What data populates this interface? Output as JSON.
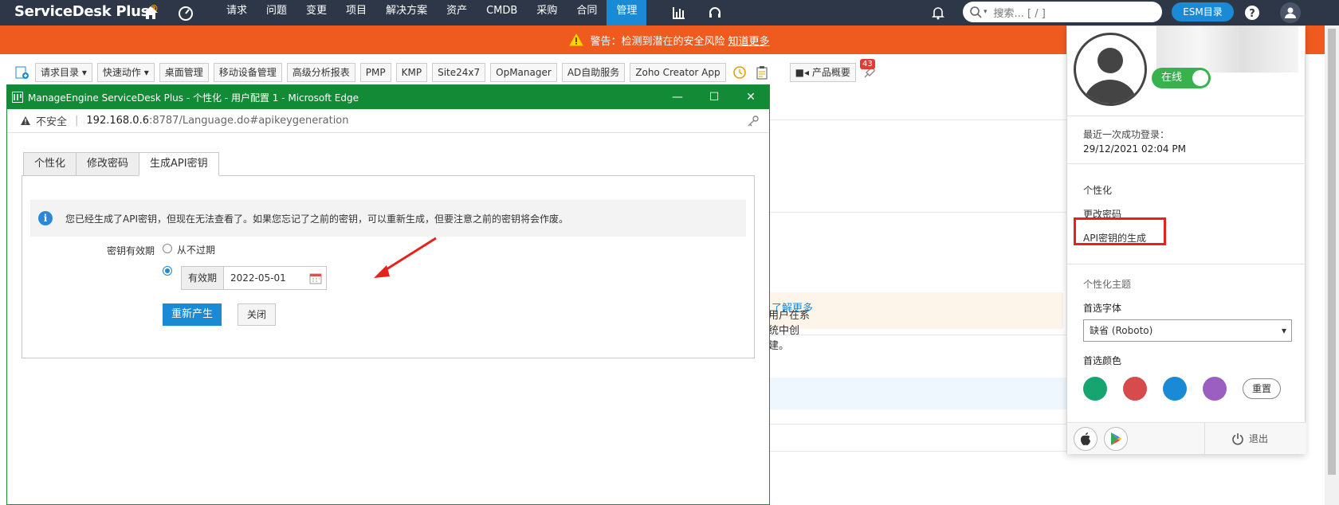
{
  "app": {
    "logo_main": "ServiceDesk Plus",
    "logo_mark": "®"
  },
  "nav": {
    "items": [
      "请求",
      "问题",
      "变更",
      "项目",
      "解决方案",
      "资产",
      "CMDB",
      "采购",
      "合同",
      "管理"
    ],
    "active": "管理",
    "search_placeholder": "搜索... [ / ]",
    "esm_label": "ESM目录"
  },
  "warning": {
    "text": "警告：检测到潜在的安全风险",
    "link": "知道更多"
  },
  "toolbar": {
    "items": [
      "请求目录",
      "快速动作",
      "桌面管理",
      "移动设备管理",
      "高级分析报表",
      "PMP",
      "KMP",
      "Site24x7",
      "OpManager",
      "AD自助服务",
      "Zoho Creator App",
      "产品概要"
    ],
    "badge": "43"
  },
  "bg": {
    "note_text": "用户在系统中创建。",
    "note_link": "了解更多"
  },
  "edge": {
    "title": "ManageEngine ServiceDesk Plus - 个性化 - 用户配置 1 - Microsoft Edge",
    "insecure": "不安全",
    "url_host": "192.168.0.6",
    "url_path": ":8787/Language.do#apikeygeneration"
  },
  "dialog": {
    "tabs": [
      "个性化",
      "修改密码",
      "生成API密钥"
    ],
    "active_tab": "生成API密钥",
    "info": "您已经生成了API密钥，但现在无法查看了。如果您忘记了之前的密钥，可以重新生成，但要注意之前的密钥将会作废。",
    "key_validity_label": "密钥有效期",
    "never_label": "从不过期",
    "valid_prefix": "有效期",
    "valid_date": "2022-05-01",
    "regen_button": "重新产生",
    "close_button": "关闭"
  },
  "profile": {
    "status": "在线",
    "last_login_label": "最近一次成功登录：",
    "last_login_value": "29/12/2021 02:04 PM",
    "links": [
      "个性化",
      "更改密码",
      "API密钥的生成"
    ],
    "theme_title": "个性化主题",
    "font_label": "首选字体",
    "font_value": "缺省 (Roboto)",
    "color_label": "首选颜色",
    "colors": [
      "#16a571",
      "#d64b4b",
      "#1a8ad4",
      "#9a5fc0"
    ],
    "reset_label": "重置",
    "logout_label": "退出"
  },
  "colors": {
    "nav_bg": "#2e3748",
    "warn_bg": "#ef5a1f",
    "edge_green": "#138a36",
    "accent": "#1a8ad4",
    "highlight": "#e8211c"
  }
}
